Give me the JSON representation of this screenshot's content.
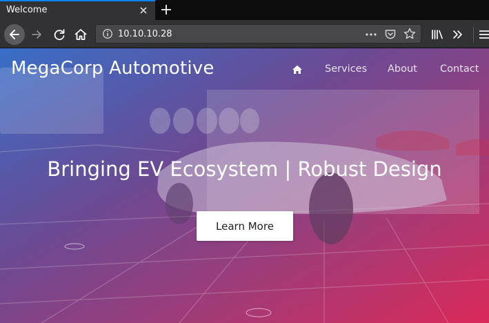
{
  "browser": {
    "tab_title": "Welcome",
    "url": "10.10.10.28",
    "accent": "#0a84ff"
  },
  "site": {
    "brand": "MegaCorp Automotive",
    "nav": {
      "home_icon": "home-icon",
      "items": [
        "Services",
        "About",
        "Contact"
      ]
    },
    "hero": {
      "headline": "Bringing EV Ecosystem | Robust Design",
      "cta_label": "Learn More"
    },
    "gradient": {
      "from": "#3a78dc",
      "via": "#9a4fa6",
      "to": "#e8285a"
    }
  }
}
